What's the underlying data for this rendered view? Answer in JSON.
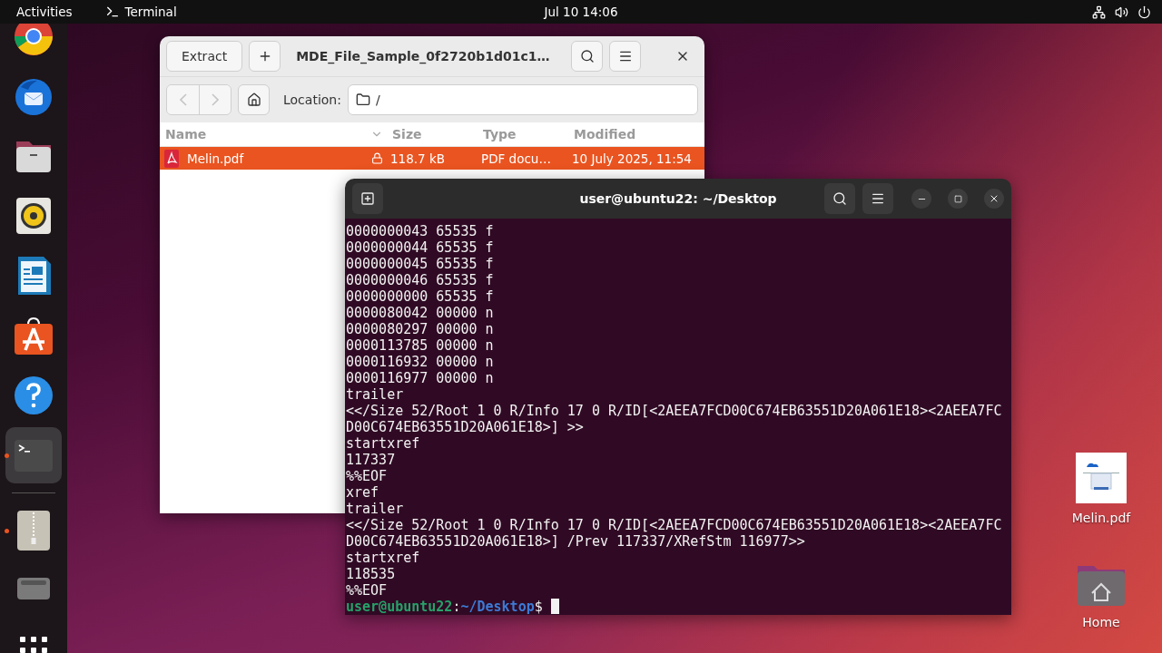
{
  "top_bar": {
    "activities": "Activities",
    "app_name": "Terminal",
    "clock": "Jul 10  14:06"
  },
  "dock": {
    "items": [
      {
        "kind": "browser",
        "running": false,
        "selected": false
      },
      {
        "kind": "mail",
        "running": false,
        "selected": false
      },
      {
        "kind": "files",
        "running": false,
        "selected": false
      },
      {
        "kind": "music",
        "running": false,
        "selected": false
      },
      {
        "kind": "writer",
        "running": false,
        "selected": false
      },
      {
        "kind": "store",
        "running": false,
        "selected": false
      },
      {
        "kind": "help",
        "running": false,
        "selected": false
      },
      {
        "kind": "terminal",
        "running": true,
        "selected": true
      },
      {
        "kind": "separator"
      },
      {
        "kind": "archive",
        "running": true,
        "selected": false
      },
      {
        "kind": "drive",
        "running": false,
        "selected": false
      },
      {
        "kind": "apps",
        "running": false,
        "selected": false
      }
    ]
  },
  "archive_window": {
    "extract_button": "Extract",
    "title": "MDE_File_Sample_0f2720b1d01c1…",
    "nav": [
      {
        "kind": "back",
        "disabled": true
      },
      {
        "kind": "forward",
        "disabled": true
      }
    ],
    "location_label": "Location:",
    "location": "/",
    "columns": [
      {
        "label": "Name",
        "sorted": true
      },
      {
        "label": "Size",
        "sorted": false
      },
      {
        "label": "Type",
        "sorted": false
      },
      {
        "label": "Modified",
        "sorted": false
      }
    ],
    "rows": [
      {
        "name": "Melin.pdf",
        "locked": true,
        "size": "118.7 kB",
        "type": "PDF docu…",
        "modified": "10 July 2025, 11:54",
        "selected": true
      }
    ]
  },
  "terminal_window": {
    "title": "user@ubuntu22: ~/Desktop",
    "lines": [
      "0000000043 65535 f",
      "0000000044 65535 f",
      "0000000045 65535 f",
      "0000000046 65535 f",
      "0000000000 65535 f",
      "0000080042 00000 n",
      "0000080297 00000 n",
      "0000113785 00000 n",
      "0000116932 00000 n",
      "0000116977 00000 n",
      "trailer",
      "<</Size 52/Root 1 0 R/Info 17 0 R/ID[<2AEEA7FCD00C674EB63551D20A061E18><2AEEA7FC",
      "D00C674EB63551D20A061E18>] >>",
      "startxref",
      "117337",
      "%%EOF",
      "xref",
      "trailer",
      "<</Size 52/Root 1 0 R/Info 17 0 R/ID[<2AEEA7FCD00C674EB63551D20A061E18><2AEEA7FC",
      "D00C674EB63551D20A061E18>] /Prev 117337/XRefStm 116977>>",
      "startxref",
      "118535",
      "%%EOF"
    ],
    "prompt": {
      "user_host": "user@ubuntu22",
      "separator": ":",
      "path": "~/Desktop",
      "symbol": "$"
    }
  },
  "desktop_icons": [
    {
      "kind": "document",
      "label": "Melin.pdf"
    },
    {
      "kind": "home",
      "label": "Home"
    }
  ]
}
